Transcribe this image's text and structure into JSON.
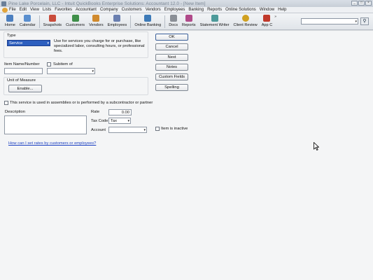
{
  "window": {
    "title": "Pine Lake Porcelain, LLC  - Intuit QuickBooks Enterprise Solutions: Accountant 12.0 - [New Item]",
    "controls": [
      "_",
      "□",
      "×"
    ]
  },
  "menu": {
    "items": [
      "File",
      "Edit",
      "View",
      "Lists",
      "Favorites",
      "Accountant",
      "Company",
      "Customers",
      "Vendors",
      "Employees",
      "Banking",
      "Reports",
      "Online Solutions",
      "Window",
      "Help"
    ]
  },
  "toolbar": {
    "buttons": [
      {
        "label": "Home",
        "color": "#4c7fc0"
      },
      {
        "label": "Calendar",
        "color": "#5a8fcf"
      },
      {
        "label": "Snapshots",
        "color": "#c94c3c"
      },
      {
        "label": "Customers",
        "color": "#3f8f4a"
      },
      {
        "label": "Vendors",
        "color": "#d08a2e"
      },
      {
        "label": "Employees",
        "color": "#6a7fb0"
      },
      {
        "label": "Online Banking",
        "color": "#3d7ab8"
      },
      {
        "label": "Docs",
        "color": "#8a8f96"
      },
      {
        "label": "Reports",
        "color": "#b04a8a"
      },
      {
        "label": "Statement Writer",
        "color": "#4d9a9a"
      },
      {
        "label": "Client Review",
        "color": "#d0a020"
      },
      {
        "label": "App C",
        "color": "#c0392b"
      }
    ],
    "more": "»",
    "search_icon": "⚲",
    "search_arrow": "▾"
  },
  "form": {
    "type_label": "Type",
    "type_value": "Service",
    "type_description": [
      "Use for services you charge for or purchase, like",
      "specialized labor, consulting hours, or professional",
      "fees."
    ],
    "item_name_label": "Item Name/Number",
    "item_name_value": "",
    "subitem_label": "Subitem of",
    "subitem_value": "",
    "unit_label": "Unit of Measure",
    "enable_button": "Enable...",
    "subcontractor_label": "This service is used in assemblies or is performed by a subcontractor or partner",
    "description_label": "Description",
    "description_value": "",
    "rate_label": "Rate",
    "rate_value": "0.00",
    "tax_code_label": "Tax Code",
    "tax_code_value": "Tax",
    "account_label": "Account",
    "account_value": "",
    "inactive_label": "Item is inactive",
    "help_link": "How can I set rates by customers or employees?"
  },
  "buttons": {
    "ok": "OK",
    "cancel": "Cancel",
    "next": "Next",
    "notes": "Notes",
    "custom_fields": "Custom Fields",
    "spelling": "Spelling"
  },
  "arrow_glyph": "▾"
}
